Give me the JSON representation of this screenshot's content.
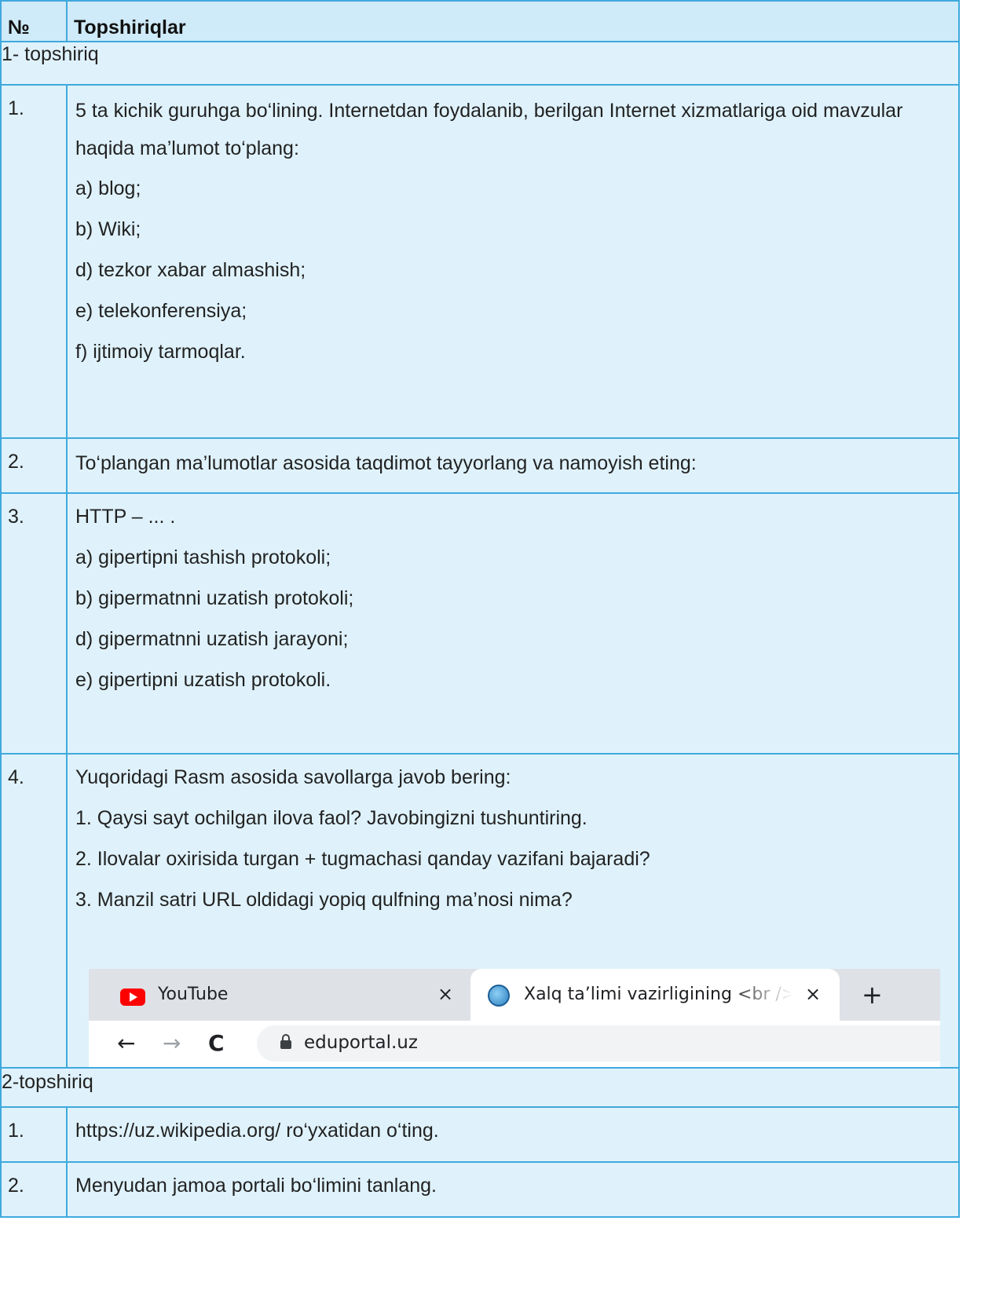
{
  "table": {
    "header": {
      "number": "№",
      "tasks": "Topshiriqlar"
    },
    "group1": {
      "title": "1- topshiriq",
      "rows": [
        {
          "number": "1.",
          "lines": [
            "5 ta kichik guruhga bo‘lining. Internetdan foydalanib, berilgan Internet xizmatlariga oid mavzular haqida ma’lumot to‘plang:",
            "a) blog;",
            "b) Wiki;",
            "d) tezkor xabar almashish;",
            "e) telekonferensiya;",
            "f) ijtimoiy tarmoqlar."
          ]
        },
        {
          "number": "2.",
          "lines": [
            "To‘plangan ma’lumotlar asosida taqdimot tayyorlang va namoyish eting:"
          ]
        },
        {
          "number": "3.",
          "lines": [
            "HTTP – ... .",
            "a) gipertipni tashish protokoli;",
            "b) gipermatnni uzatish protokoli;",
            "d) gipermatnni uzatish jarayoni;",
            "e) gipertipni uzatish protokoli."
          ]
        },
        {
          "number": "4.",
          "lines": [
            "Yuqoridagi Rasm asosida savollarga javob bering:",
            "1. Qaysi sayt ochilgan ilova faol? Javobingizni tushuntiring.",
            "2. Ilovalar oxirisida turgan + tugmachasi qanday vazifani bajaradi?",
            "3. Manzil satri URL oldidagi yopiq qulfning ma’nosi nima?"
          ]
        }
      ]
    },
    "group2": {
      "title": "2-topshiriq",
      "rows": [
        {
          "number": "1.",
          "lines": [
            "https://uz.wikipedia.org/ ro‘yxatidan o‘ting."
          ]
        },
        {
          "number": "2.",
          "lines": [
            "Menyudan jamoa portali bo‘limini tanlang."
          ]
        }
      ]
    }
  },
  "browser": {
    "tabs": [
      {
        "title": "YouTube",
        "icon": "youtube-icon",
        "close": "×"
      },
      {
        "title": "Xalq ta’limi vazirligining <br /> A",
        "icon": "globe-icon",
        "close": "×",
        "active": true
      }
    ],
    "new_tab": "+",
    "nav": {
      "back": "←",
      "forward": "→",
      "reload": "C"
    },
    "url": "eduportal.uz",
    "colors": {
      "tabbar": "#dee1e6",
      "omnibox": "#f1f3f4",
      "youtube": "#ff0000"
    }
  }
}
